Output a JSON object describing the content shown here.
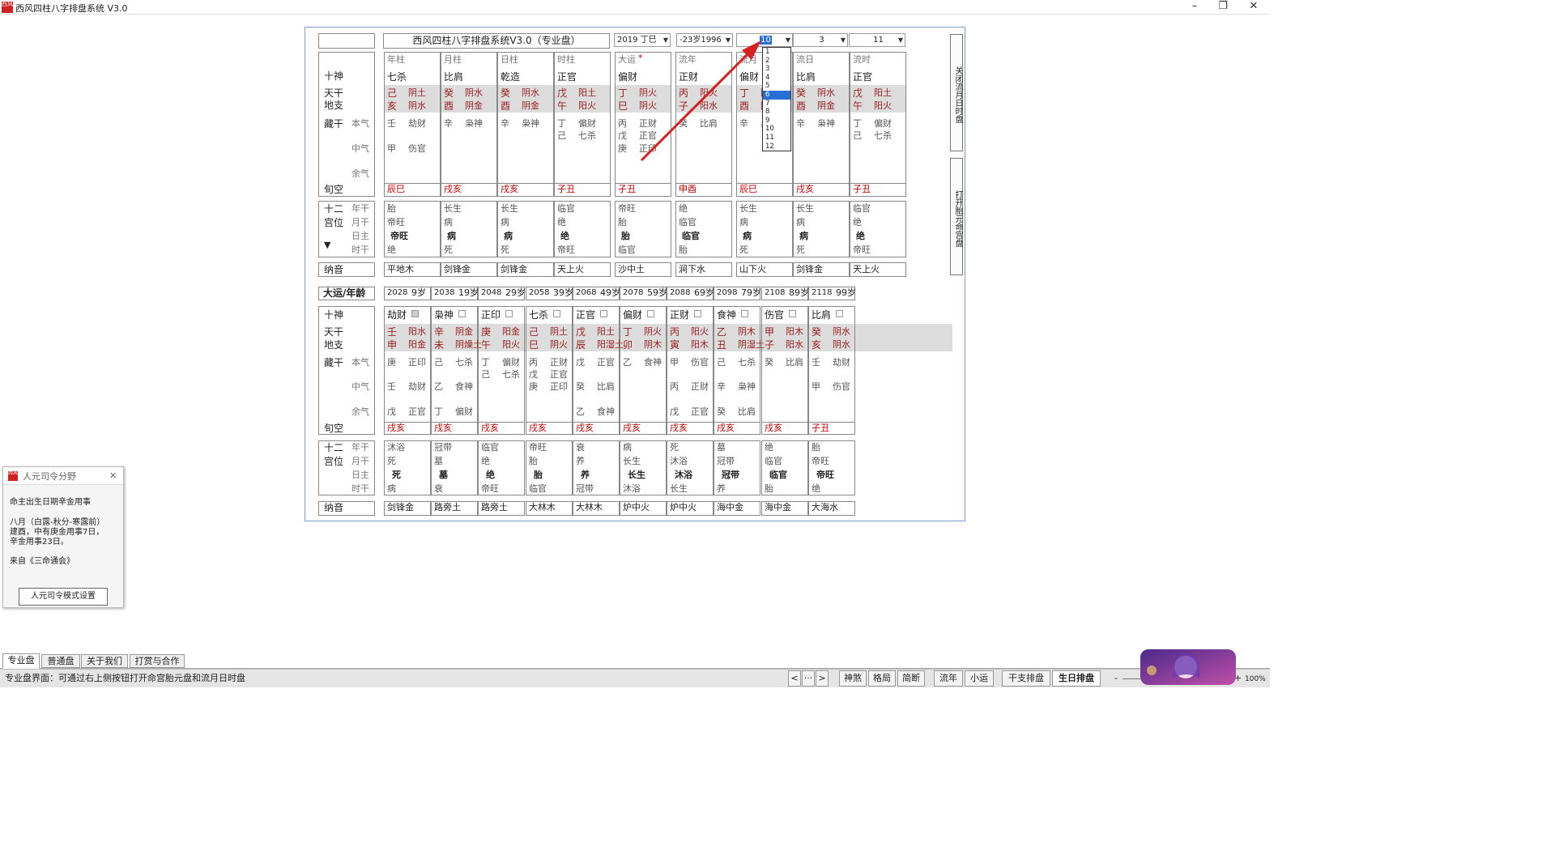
{
  "window": {
    "icon_text": "西风",
    "title": "西风四柱八字排盘系统 V3.0",
    "min": "–",
    "max": "❐",
    "close": "✕"
  },
  "top_controls": {
    "chart_title": "西风四柱八字排盘系统V3.0（专业盘）",
    "year_select": "2019 丁巳",
    "age_select": "-23岁1996",
    "month_select": "10",
    "day_select": "3",
    "hour_select": "11"
  },
  "month_dropdown": [
    "1",
    "2",
    "3",
    "4",
    "5",
    "6",
    "7",
    "8",
    "9",
    "10",
    "11",
    "12"
  ],
  "month_dropdown_selected": "6",
  "side_buttons": {
    "close_flow": "关闭流月日时盘",
    "open_palace": "打开胎元命宫盘"
  },
  "upper": {
    "labels": {
      "ten_gods": "十神",
      "tiangan": "天干",
      "dizhi": "地支",
      "canggan": "藏干",
      "benqi": "本气",
      "zhongqi": "中气",
      "yuqi": "余气",
      "xunkong": "旬空",
      "shier": "十二",
      "gongwei": "宫位",
      "niangan": "年干",
      "yuegan": "月干",
      "rizhu": "日主",
      "shigan": "时干",
      "arrow": "▼",
      "nayin": "纳音"
    },
    "pillars": [
      {
        "hdr": "年柱",
        "hdr_mark": "",
        "god": "七杀",
        "gan": "己",
        "gan_wx": "阴土",
        "zhi": "亥",
        "zhi_wx": "阴水",
        "cang": [
          [
            "壬",
            "劫财"
          ],
          [
            "甲",
            "伤官"
          ],
          [
            "",
            ""
          ]
        ],
        "xunkong": "辰巳",
        "xunkong_red": true,
        "s1": "胎",
        "s2": "帝旺",
        "s3": "帝旺",
        "s4": "绝",
        "nayin": "平地木"
      },
      {
        "hdr": "月柱",
        "hdr_mark": "",
        "god": "比肩",
        "gan": "癸",
        "gan_wx": "阴水",
        "zhi": "酉",
        "zhi_wx": "阴金",
        "cang": [
          [
            "辛",
            "枭神"
          ],
          [
            "",
            ""
          ],
          [
            "",
            ""
          ]
        ],
        "xunkong": "戌亥",
        "xunkong_red": true,
        "s1": "长生",
        "s2": "病",
        "s3": "病",
        "s4": "死",
        "nayin": "剑锋金"
      },
      {
        "hdr": "日柱",
        "hdr_mark": "",
        "god": "乾造",
        "gan": "癸",
        "gan_wx": "阴水",
        "zhi": "酉",
        "zhi_wx": "阴金",
        "cang": [
          [
            "辛",
            "枭神"
          ],
          [
            "",
            ""
          ],
          [
            "",
            ""
          ]
        ],
        "xunkong": "戌亥",
        "xunkong_red": true,
        "s1": "长生",
        "s2": "病",
        "s3": "病",
        "s4": "死",
        "nayin": "剑锋金"
      },
      {
        "hdr": "时柱",
        "hdr_mark": "",
        "god": "正官",
        "gan": "戊",
        "gan_wx": "阳土",
        "zhi": "午",
        "zhi_wx": "阳火",
        "cang": [
          [
            "丁",
            "偏财"
          ],
          [
            "己",
            "七杀"
          ],
          [
            "",
            ""
          ]
        ],
        "xunkong": "子丑",
        "xunkong_red": true,
        "s1": "临官",
        "s2": "绝",
        "s3": "绝",
        "s4": "帝旺",
        "nayin": "天上火"
      },
      {
        "hdr": "大运",
        "hdr_mark": "*",
        "god": "偏财",
        "gan": "丁",
        "gan_wx": "阴火",
        "zhi": "巳",
        "zhi_wx": "阴火",
        "cang": [
          [
            "丙",
            "正财"
          ],
          [
            "戊",
            "正官"
          ],
          [
            "庚",
            "正印"
          ]
        ],
        "xunkong": "子丑",
        "xunkong_red": true,
        "s1": "帝旺",
        "s2": "胎",
        "s3": "胎",
        "s4": "临官",
        "nayin": "沙中土"
      },
      {
        "hdr": "流年",
        "hdr_mark": "",
        "god": "正财",
        "gan": "丙",
        "gan_wx": "阳火",
        "zhi": "子",
        "zhi_wx": "阳水",
        "cang": [
          [
            "癸",
            "比肩"
          ],
          [
            "",
            ""
          ],
          [
            "",
            ""
          ]
        ],
        "xunkong": "申酉",
        "xunkong_red": true,
        "s1": "绝",
        "s2": "临官",
        "s3": "临官",
        "s4": "胎",
        "nayin": "涧下水"
      },
      {
        "hdr": "流月",
        "hdr_mark": "",
        "god": "偏财",
        "gan": "丁",
        "gan_wx": "阴火",
        "zhi": "酉",
        "zhi_wx": "阴金",
        "cang": [
          [
            "辛",
            "枭神"
          ],
          [
            "",
            ""
          ],
          [
            "",
            ""
          ]
        ],
        "xunkong": "辰巳",
        "xunkong_red": true,
        "s1": "长生",
        "s2": "病",
        "s3": "病",
        "s4": "死",
        "nayin": "山下火"
      },
      {
        "hdr": "流日",
        "hdr_mark": "",
        "god": "比肩",
        "gan": "癸",
        "gan_wx": "阴水",
        "zhi": "酉",
        "zhi_wx": "阴金",
        "cang": [
          [
            "辛",
            "枭神"
          ],
          [
            "",
            ""
          ],
          [
            "",
            ""
          ]
        ],
        "xunkong": "戌亥",
        "xunkong_red": true,
        "s1": "长生",
        "s2": "病",
        "s3": "病",
        "s4": "死",
        "nayin": "剑锋金"
      },
      {
        "hdr": "流时",
        "hdr_mark": "",
        "god": "正官",
        "gan": "戊",
        "gan_wx": "阳土",
        "zhi": "午",
        "zhi_wx": "阳火",
        "cang": [
          [
            "丁",
            "偏财"
          ],
          [
            "己",
            "七杀"
          ],
          [
            "",
            ""
          ]
        ],
        "xunkong": "子丑",
        "xunkong_red": true,
        "s1": "临官",
        "s2": "绝",
        "s3": "绝",
        "s4": "帝旺",
        "nayin": "天上火"
      }
    ]
  },
  "dayun": {
    "label": "大运/年龄",
    "years": [
      [
        "2028",
        "9岁"
      ],
      [
        "2038",
        "19岁"
      ],
      [
        "2048",
        "29岁"
      ],
      [
        "2058",
        "39岁"
      ],
      [
        "2068",
        "49岁"
      ],
      [
        "2078",
        "59岁"
      ],
      [
        "2088",
        "69岁"
      ],
      [
        "2098",
        "79岁"
      ],
      [
        "2108",
        "89岁"
      ],
      [
        "2118",
        "99岁"
      ]
    ],
    "cols": [
      {
        "god": "劫财",
        "gan": "壬",
        "gan_wx": "阳水",
        "zhi": "申",
        "zhi_wx": "阳金",
        "cang": [
          [
            "庚",
            "正印"
          ],
          [
            "壬",
            "劫财"
          ],
          [
            "戊",
            "正官"
          ],
          [
            "",
            ""
          ]
        ],
        "xunkong": "戌亥",
        "s1": "沐浴",
        "s2": "死",
        "s3": "死",
        "s4": "病",
        "nayin": "剑锋金"
      },
      {
        "god": "枭神",
        "gan": "辛",
        "gan_wx": "阴金",
        "zhi": "未",
        "zhi_wx": "阴燥土",
        "cang": [
          [
            "己",
            "七杀"
          ],
          [
            "乙",
            "食神"
          ],
          [
            "丁",
            "偏财"
          ],
          [
            "",
            ""
          ]
        ],
        "xunkong": "戌亥",
        "s1": "冠带",
        "s2": "墓",
        "s3": "墓",
        "s4": "衰",
        "nayin": "路旁土"
      },
      {
        "god": "正印",
        "gan": "庚",
        "gan_wx": "阳金",
        "zhi": "午",
        "zhi_wx": "阳火",
        "cang": [
          [
            "丁",
            "偏财"
          ],
          [
            "己",
            "七杀"
          ],
          [
            "",
            ""
          ],
          [
            "",
            ""
          ]
        ],
        "xunkong": "戌亥",
        "s1": "临官",
        "s2": "绝",
        "s3": "绝",
        "s4": "帝旺",
        "nayin": "路旁土"
      },
      {
        "god": "七杀",
        "gan": "己",
        "gan_wx": "阴土",
        "zhi": "巳",
        "zhi_wx": "阴火",
        "cang": [
          [
            "丙",
            "正财"
          ],
          [
            "戊",
            "正官"
          ],
          [
            "庚",
            "正印"
          ],
          [
            "",
            ""
          ]
        ],
        "xunkong": "戌亥",
        "s1": "帝旺",
        "s2": "胎",
        "s3": "胎",
        "s4": "临官",
        "nayin": "大林木"
      },
      {
        "god": "正官",
        "gan": "戊",
        "gan_wx": "阳土",
        "zhi": "辰",
        "zhi_wx": "阳湿土",
        "cang": [
          [
            "戊",
            "正官"
          ],
          [
            "癸",
            "比肩"
          ],
          [
            "乙",
            "食神"
          ],
          [
            "",
            ""
          ]
        ],
        "xunkong": "戌亥",
        "s1": "衰",
        "s2": "养",
        "s3": "养",
        "s4": "冠带",
        "nayin": "大林木"
      },
      {
        "god": "偏财",
        "gan": "丁",
        "gan_wx": "阴火",
        "zhi": "卯",
        "zhi_wx": "阴木",
        "cang": [
          [
            "乙",
            "食神"
          ],
          [
            "",
            ""
          ],
          [
            "",
            ""
          ],
          [
            "",
            ""
          ]
        ],
        "xunkong": "戌亥",
        "s1": "病",
        "s2": "长生",
        "s3": "长生",
        "s4": "沐浴",
        "nayin": "炉中火"
      },
      {
        "god": "正财",
        "gan": "丙",
        "gan_wx": "阳火",
        "zhi": "寅",
        "zhi_wx": "阳木",
        "cang": [
          [
            "甲",
            "伤官"
          ],
          [
            "丙",
            "正财"
          ],
          [
            "戊",
            "正官"
          ],
          [
            "",
            ""
          ]
        ],
        "xunkong": "戌亥",
        "s1": "死",
        "s2": "沐浴",
        "s3": "沐浴",
        "s4": "长生",
        "nayin": "炉中火"
      },
      {
        "god": "食神",
        "gan": "乙",
        "gan_wx": "阴木",
        "zhi": "丑",
        "zhi_wx": "阴湿土",
        "cang": [
          [
            "己",
            "七杀"
          ],
          [
            "辛",
            "枭神"
          ],
          [
            "癸",
            "比肩"
          ],
          [
            "",
            ""
          ]
        ],
        "xunkong": "戌亥",
        "s1": "墓",
        "s2": "冠带",
        "s3": "冠带",
        "s4": "养",
        "nayin": "海中金"
      },
      {
        "god": "伤官",
        "gan": "甲",
        "gan_wx": "阳木",
        "zhi": "子",
        "zhi_wx": "阳水",
        "cang": [
          [
            "癸",
            "比肩"
          ],
          [
            "",
            ""
          ],
          [
            "",
            ""
          ],
          [
            "",
            ""
          ]
        ],
        "xunkong": "戌亥",
        "s1": "绝",
        "s2": "临官",
        "s3": "临官",
        "s4": "胎",
        "nayin": "海中金"
      },
      {
        "god": "比肩",
        "gan": "癸",
        "gan_wx": "阴水",
        "zhi": "亥",
        "zhi_wx": "阴水",
        "cang": [
          [
            "壬",
            "劫财"
          ],
          [
            "甲",
            "伤官"
          ],
          [
            "",
            ""
          ],
          [
            "",
            ""
          ]
        ],
        "xunkong": "子丑",
        "s1": "胎",
        "s2": "帝旺",
        "s3": "帝旺",
        "s4": "绝",
        "nayin": "大海水"
      }
    ]
  },
  "dialog": {
    "title": "人元司令分野",
    "close": "✕",
    "line1": "命主出生日期辛金用事",
    "line2": "八月（白露-秋分-寒露前）",
    "line3": "建酉，中有庚金用事7日，",
    "line4": "辛金用事23日。",
    "line5": "来自《三命通会》",
    "button": "人元司令模式设置"
  },
  "tabs": [
    "专业盘",
    "普通盘",
    "关于我们",
    "打赏与合作"
  ],
  "status": {
    "text": "专业盘界面：可通过右上侧按钮打开命宫胎元盘和流月日时盘",
    "nav": [
      "<",
      "···",
      ">"
    ],
    "buttons": [
      "神煞",
      "格局",
      "简断",
      "流年",
      "小运",
      "干支排盘",
      "生日排盘"
    ],
    "zoom_minus": "-",
    "zoom_plus": "+",
    "zoom": "100%"
  },
  "colors": {
    "accent_border": "#7a9cd3",
    "red": "#cc0000",
    "dark_red": "#9b1c1c",
    "band": "#dcdcdc",
    "dropdown_selected": "#2a6fd6"
  },
  "icons": [
    "app-icon",
    "minimize-icon",
    "maximize-icon",
    "close-icon",
    "dropdown-arrow-icon",
    "checkbox-icon",
    "red-arrow-annotation",
    "anime-avatar-image"
  ]
}
